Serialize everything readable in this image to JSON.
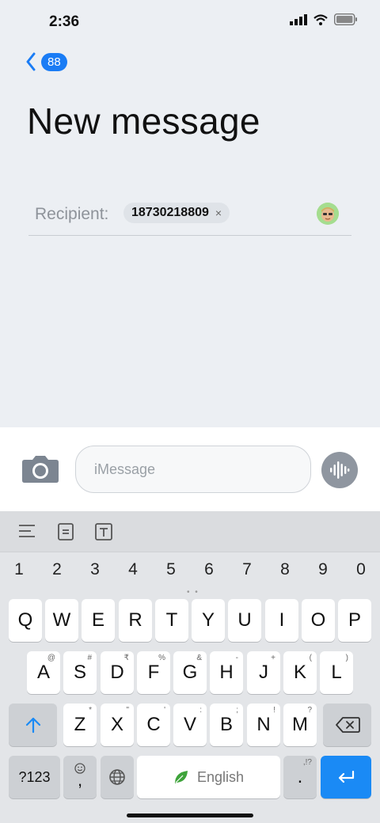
{
  "status_bar": {
    "time": "2:36"
  },
  "nav": {
    "back_count": "88"
  },
  "page": {
    "title": "New message"
  },
  "recipient": {
    "label": "Recipient:",
    "number": "18730218809",
    "remove_glyph": "×"
  },
  "composer": {
    "placeholder": "iMessage"
  },
  "keyboard": {
    "numbers": [
      "1",
      "2",
      "3",
      "4",
      "5",
      "6",
      "7",
      "8",
      "9",
      "0"
    ],
    "row1": [
      "Q",
      "W",
      "E",
      "R",
      "T",
      "Y",
      "U",
      "I",
      "O",
      "P"
    ],
    "row2": [
      {
        "label": "A",
        "sup": "@"
      },
      {
        "label": "S",
        "sup": "#"
      },
      {
        "label": "D",
        "sup": "₹"
      },
      {
        "label": "F",
        "sup": "%"
      },
      {
        "label": "G",
        "sup": "&"
      },
      {
        "label": "H",
        "sup": "-"
      },
      {
        "label": "J",
        "sup": "+"
      },
      {
        "label": "K",
        "sup": "("
      },
      {
        "label": "L",
        "sup": ")"
      }
    ],
    "row3": [
      {
        "label": "Z",
        "sup": "*"
      },
      {
        "label": "X",
        "sup": "\""
      },
      {
        "label": "C",
        "sup": "'"
      },
      {
        "label": "V",
        "sup": ":"
      },
      {
        "label": "B",
        "sup": ";"
      },
      {
        "label": "N",
        "sup": "!"
      },
      {
        "label": "M",
        "sup": "?"
      }
    ],
    "symbols_label": "?123",
    "comma_label": ",",
    "space_label": "English",
    "period_label": ".",
    "period_sup": ",!?"
  },
  "colors": {
    "accent": "#1a7cf5",
    "enter": "#1a8af5",
    "background": "#eceff3"
  }
}
